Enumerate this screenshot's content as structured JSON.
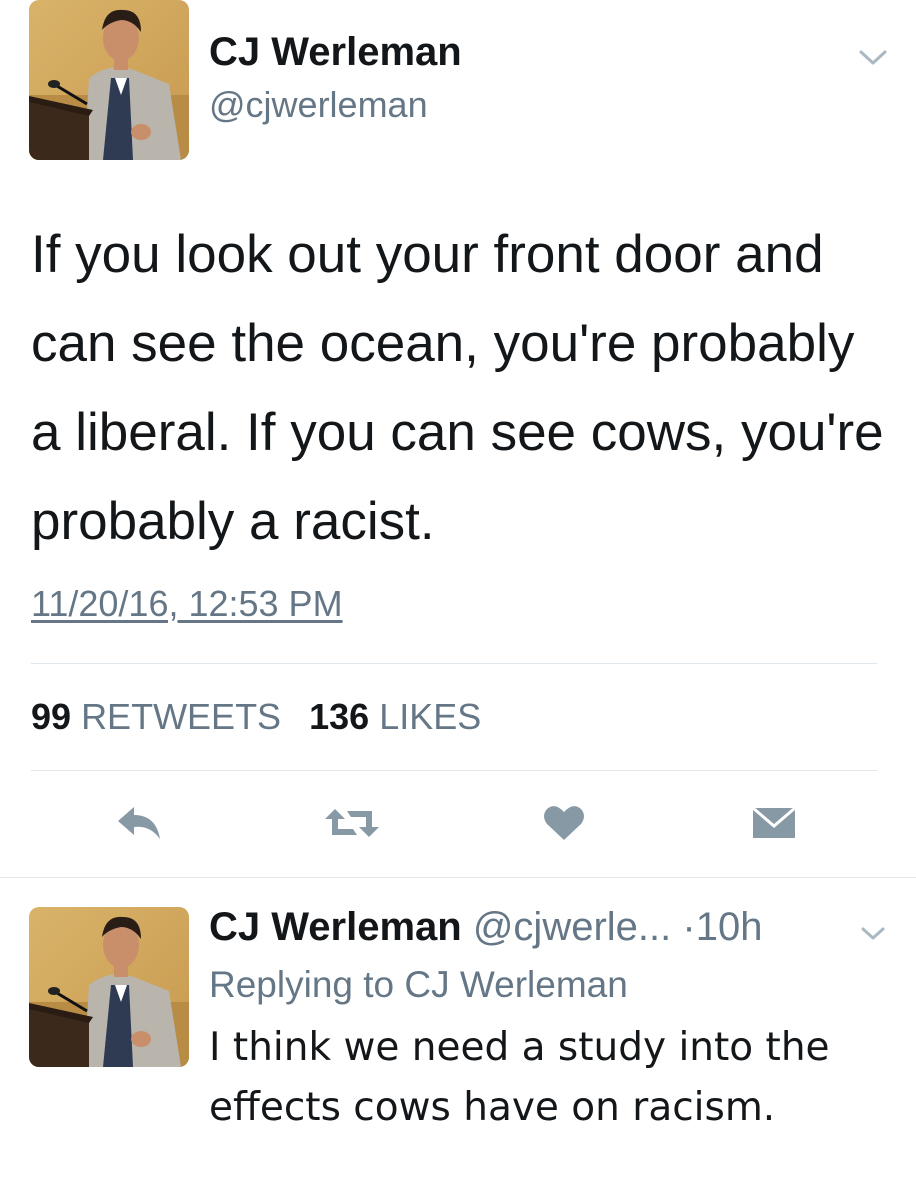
{
  "main_tweet": {
    "author_name": "CJ Werleman",
    "author_handle": "@cjwerleman",
    "text": "If you look out your front door and can see the ocean, you're probably a liberal. If you can see cows, you're probably a racist.",
    "timestamp": "11/20/16, 12:53 PM",
    "stats": {
      "retweets_count": "99",
      "retweets_label": "RETWEETS",
      "likes_count": "136",
      "likes_label": "LIKES"
    },
    "actions": [
      "reply-icon",
      "retweet-icon",
      "heart-icon",
      "direct-message-icon"
    ],
    "colors": {
      "primary_text": "#14171a",
      "secondary_text": "#657786",
      "icon": "#8899a6",
      "divider": "#e1e8ed"
    }
  },
  "reply_tweet": {
    "author_name": "CJ Werleman",
    "author_handle": "@cjwerle...",
    "time": "10h",
    "replying_prefix": "Replying to",
    "replying_to": "CJ Werleman",
    "text": "I think we need a study into the effects cows have on racism."
  }
}
